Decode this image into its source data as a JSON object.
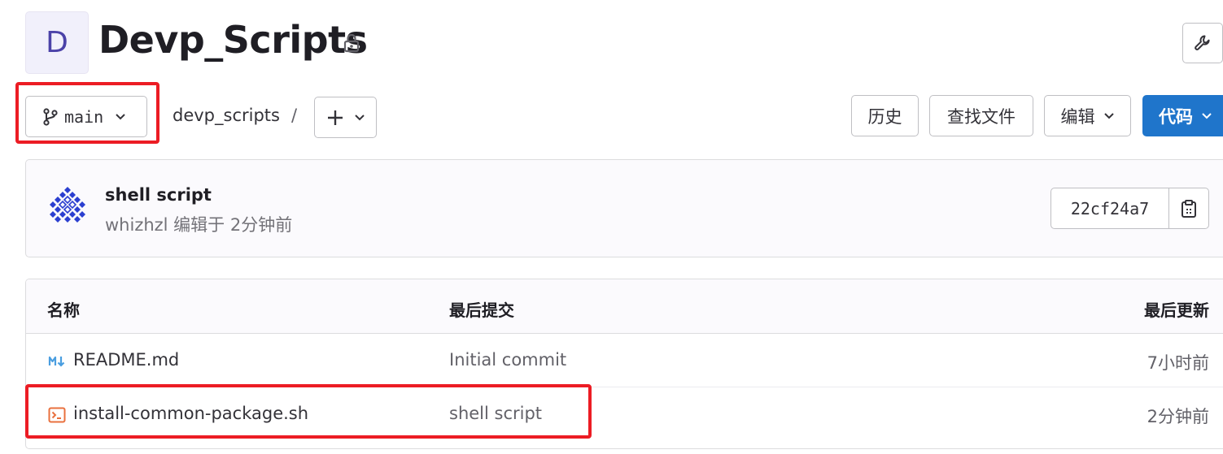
{
  "project": {
    "avatar_letter": "D",
    "title": "Devp_Scripts",
    "visibility_icon": "lock-icon",
    "settings_icon": "wrench-icon"
  },
  "toolbar": {
    "branch": "main",
    "path_root": "devp_scripts",
    "path_separator": "/",
    "add_icon": "plus-icon",
    "history_label": "历史",
    "find_file_label": "查找文件",
    "edit_label": "编辑",
    "code_label": "代码"
  },
  "last_commit": {
    "title": "shell script",
    "meta": "whizhzl 编辑于 2分钟前",
    "sha": "22cf24a7",
    "copy_icon": "clipboard-icon"
  },
  "file_table": {
    "headers": [
      "名称",
      "最后提交",
      "最后更新"
    ],
    "rows": [
      {
        "name": "README.md",
        "icon": "markdown-icon",
        "commit": "Initial commit",
        "updated": "7小时前"
      },
      {
        "name": "install-common-package.sh",
        "icon": "terminal-file-icon",
        "commit": "shell script",
        "updated": "2分钟前"
      }
    ]
  },
  "colors": {
    "primary": "#1f75cb",
    "highlight_box": "#ec1c24",
    "markdown_icon": "#4a9ee0",
    "shell_icon": "#e9703e"
  }
}
